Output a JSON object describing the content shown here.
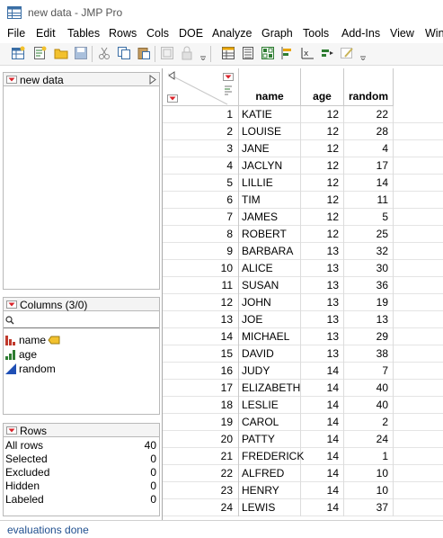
{
  "window": {
    "title": "new data - JMP Pro"
  },
  "menu": [
    "File",
    "Edit",
    "Tables",
    "Rows",
    "Cols",
    "DOE",
    "Analyze",
    "Graph",
    "Tools",
    "Add-Ins",
    "View",
    "Win"
  ],
  "toolbar": {
    "icons": [
      "new-data-table-icon",
      "new-script-icon",
      "open-icon",
      "save-icon",
      "cut-icon",
      "copy-icon",
      "paste-icon",
      "snapshot-icon",
      "lock-icon",
      "dropdown-icon",
      "data-table-icon",
      "subset-icon",
      "sort-icon",
      "graph-builder-icon",
      "distribution-icon",
      "fit-model-icon",
      "annotate-icon",
      "dropdown-icon-2"
    ]
  },
  "table_panel": {
    "label": "new data"
  },
  "columns_panel": {
    "label": "Columns (3/0)",
    "items": [
      {
        "name": "name",
        "type": "nominal",
        "key": true
      },
      {
        "name": "age",
        "type": "ordinal",
        "key": false
      },
      {
        "name": "random",
        "type": "continuous",
        "key": false
      }
    ]
  },
  "rows_panel": {
    "label": "Rows",
    "items": [
      {
        "label": "All rows",
        "value": "40"
      },
      {
        "label": "Selected",
        "value": "0"
      },
      {
        "label": "Excluded",
        "value": "0"
      },
      {
        "label": "Hidden",
        "value": "0"
      },
      {
        "label": "Labeled",
        "value": "0"
      }
    ]
  },
  "grid": {
    "columns": [
      "name",
      "age",
      "random"
    ],
    "rows": [
      [
        "1",
        "KATIE",
        "12",
        "22"
      ],
      [
        "2",
        "LOUISE",
        "12",
        "28"
      ],
      [
        "3",
        "JANE",
        "12",
        "4"
      ],
      [
        "4",
        "JACLYN",
        "12",
        "17"
      ],
      [
        "5",
        "LILLIE",
        "12",
        "14"
      ],
      [
        "6",
        "TIM",
        "12",
        "11"
      ],
      [
        "7",
        "JAMES",
        "12",
        "5"
      ],
      [
        "8",
        "ROBERT",
        "12",
        "25"
      ],
      [
        "9",
        "BARBARA",
        "13",
        "32"
      ],
      [
        "10",
        "ALICE",
        "13",
        "30"
      ],
      [
        "11",
        "SUSAN",
        "13",
        "36"
      ],
      [
        "12",
        "JOHN",
        "13",
        "19"
      ],
      [
        "13",
        "JOE",
        "13",
        "13"
      ],
      [
        "14",
        "MICHAEL",
        "13",
        "29"
      ],
      [
        "15",
        "DAVID",
        "13",
        "38"
      ],
      [
        "16",
        "JUDY",
        "14",
        "7"
      ],
      [
        "17",
        "ELIZABETH",
        "14",
        "40"
      ],
      [
        "18",
        "LESLIE",
        "14",
        "40"
      ],
      [
        "19",
        "CAROL",
        "14",
        "2"
      ],
      [
        "20",
        "PATTY",
        "14",
        "24"
      ],
      [
        "21",
        "FREDERICK",
        "14",
        "1"
      ],
      [
        "22",
        "ALFRED",
        "14",
        "10"
      ],
      [
        "23",
        "HENRY",
        "14",
        "10"
      ],
      [
        "24",
        "LEWIS",
        "14",
        "37"
      ]
    ]
  },
  "status": {
    "text": "evaluations done"
  },
  "colors": {
    "hotspot_red": "#d9232a",
    "status_text": "#1f4f8f",
    "panel_border": "#b9b9b9"
  }
}
